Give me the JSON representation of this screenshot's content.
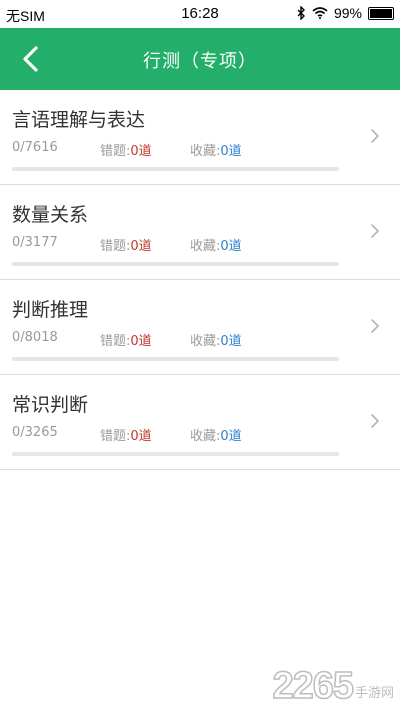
{
  "status": {
    "carrier": "无SIM",
    "time": "16:28",
    "battery": "99%",
    "icons": [
      "bluetooth-icon",
      "wifi-icon",
      "battery-icon"
    ]
  },
  "nav": {
    "title": "行测（专项）",
    "back_icon": "chevron-left-icon",
    "color": "#23ae6a"
  },
  "categories": [
    {
      "name": "言语理解与表达",
      "progress": "0/7616",
      "progress_fraction": 0,
      "wrong_label": "错题:",
      "wrong_value": "0道",
      "fav_label": "收藏:",
      "fav_value": "0道"
    },
    {
      "name": "数量关系",
      "progress": "0/3177",
      "progress_fraction": 0,
      "wrong_label": "错题:",
      "wrong_value": "0道",
      "fav_label": "收藏:",
      "fav_value": "0道"
    },
    {
      "name": "判断推理",
      "progress": "0/8018",
      "progress_fraction": 0,
      "wrong_label": "错题:",
      "wrong_value": "0道",
      "fav_label": "收藏:",
      "fav_value": "0道"
    },
    {
      "name": "常识判断",
      "progress": "0/3265",
      "progress_fraction": 0,
      "wrong_label": "错题:",
      "wrong_value": "0道",
      "fav_label": "收藏:",
      "fav_value": "0道"
    }
  ],
  "watermark": {
    "number": "2265",
    "text": "手游网"
  }
}
